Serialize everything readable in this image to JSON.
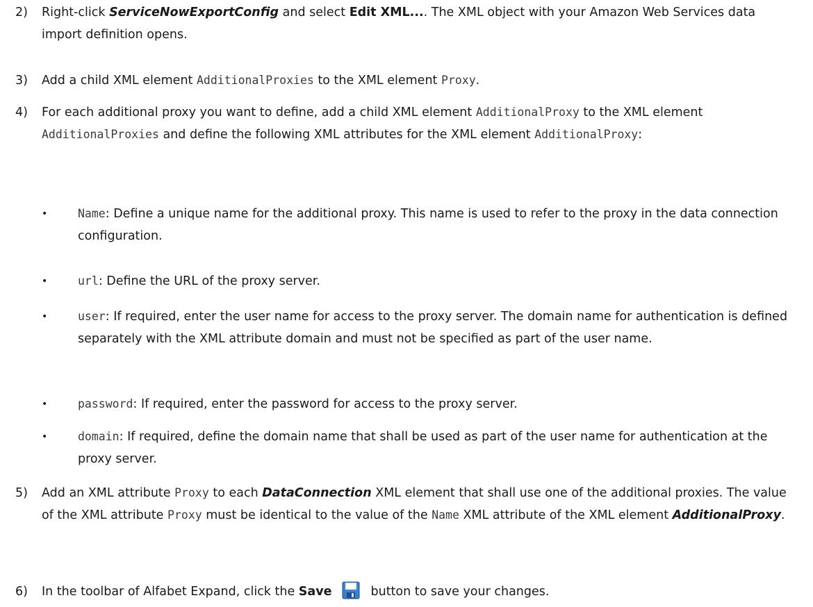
{
  "steps": [
    {
      "num": "2)",
      "pre": "Right-click ",
      "target": "ServiceNowExportConfig",
      "mid": " and select ",
      "action": "Edit XML...",
      "post": ". The XML object with your Amazon Web Services data import definition opens."
    },
    {
      "num": "3)",
      "pre": "Add a child XML element ",
      "code1": "AdditionalProxies",
      "mid": " to the XML element ",
      "code2": "Proxy",
      "post": "."
    },
    {
      "num": "4)",
      "pre": "For each additional proxy you want to define, add a child XML element ",
      "code1": "AdditionalProxy",
      "mid1": " to the XML element ",
      "code2": "AdditionalProxies",
      "mid2": " and define the following XML attributes for the XML element ",
      "code3": "AdditionalProxy",
      "post": ":"
    },
    {
      "num": "5)",
      "pre": "Add an XML attribute ",
      "code1": "Proxy",
      "mid1": " to each ",
      "elem1": "DataConnection",
      "mid2": " XML element that shall use one of the additional proxies. The value of the XML attribute ",
      "code2": "Proxy",
      "mid3": " must be identical to the value of the ",
      "code3": "Name",
      "mid4": " XML attribute of the XML element ",
      "elem2": "AdditionalProxy",
      "post": "."
    },
    {
      "num": "6)",
      "pre": "In the toolbar of Alfabet Expand, click the ",
      "button": "Save",
      "icon": "floppy-disk-save-icon",
      "post": "button to save your changes."
    }
  ],
  "attributes": [
    {
      "name": "Name",
      "desc": ": Define a unique name for the additional proxy. This name is used to refer to the proxy in the data connection configuration."
    },
    {
      "name": "url",
      "desc": ": Define the URL of the proxy server."
    },
    {
      "name": "user",
      "desc": ": If required, enter the user name for access to the proxy server. The domain name for authentication is defined separately with the XML attribute domain and must not be specified as part of the user name."
    },
    {
      "name": "password",
      "desc": ": If required, enter the password for access to the proxy server."
    },
    {
      "name": "domain",
      "desc": ": If required, define the domain name that shall be used as part of the user name for authentication at the proxy server."
    }
  ],
  "colors": {
    "text": "#1a1a1a",
    "code": "#3a3a3a",
    "icon_blue": "#2f6fb6"
  }
}
